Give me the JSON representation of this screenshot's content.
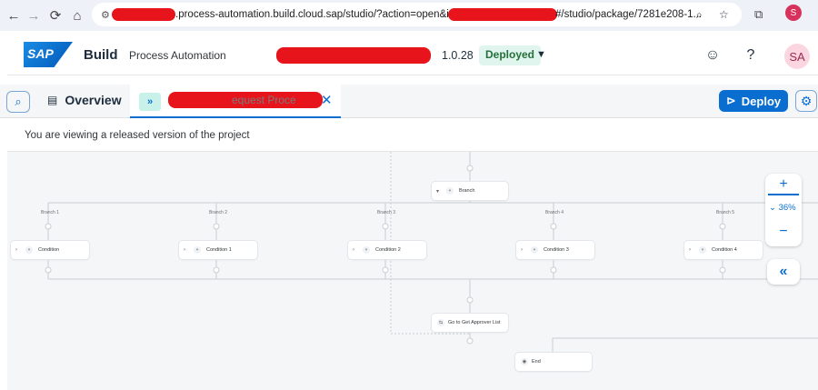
{
  "browser": {
    "url_visible": ".process-automation.build.cloud.sap/studio/?action=open&id=us10",
    "url_tail": "#/studio/package/7281e208-1...",
    "profile_initial": "S"
  },
  "shell": {
    "brand": "Build",
    "product": "Process Automation",
    "version": "1.0.28",
    "status": "Deployed",
    "avatar_initials": "SA"
  },
  "tabs": {
    "overview_label": "Overview",
    "active_tab_partial": "equest Proce",
    "deploy_label": "Deploy"
  },
  "info_message": "You are viewing a released version of the project",
  "canvas": {
    "top_node": "Branch",
    "branch_labels": [
      "Branch 1",
      "Branch 2",
      "Branch 3",
      "Branch 4",
      "Branch 5"
    ],
    "conditions": [
      "Condition",
      "Condition 1",
      "Condition 2",
      "Condition 3",
      "Condition 4"
    ],
    "approver_node": "Go to Get Approver List",
    "end_node": "End",
    "zoom": "36%"
  }
}
